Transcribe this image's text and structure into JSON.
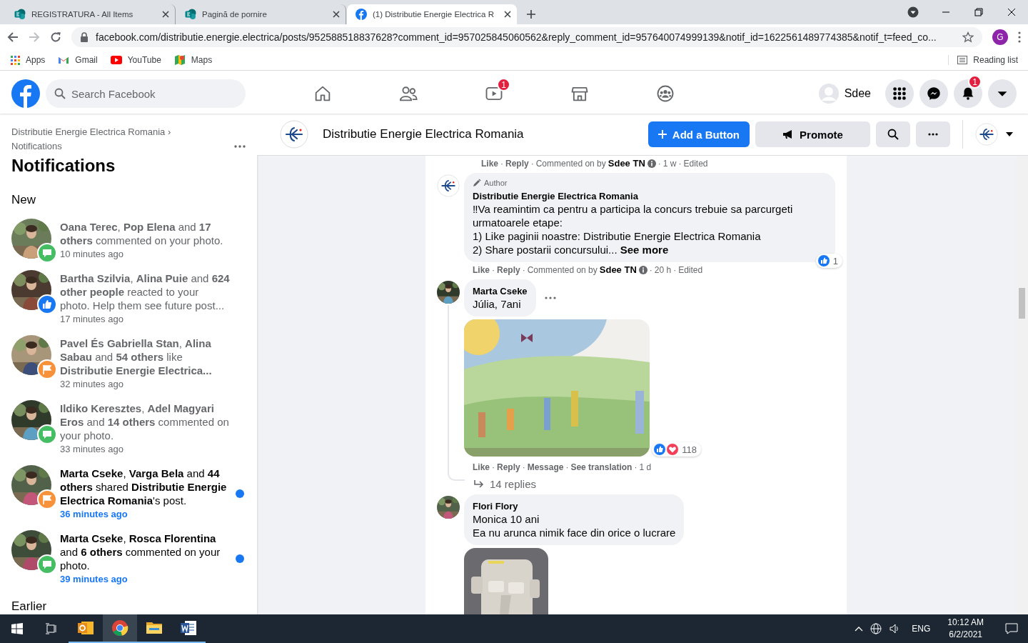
{
  "browser": {
    "tabs": [
      {
        "title": "REGISTRATURA - All Items",
        "kind": "sharepoint",
        "selected": false
      },
      {
        "title": "Pagină de pornire",
        "kind": "sharepoint",
        "selected": false
      },
      {
        "title": "(1) Distributie Energie Electrica R",
        "kind": "facebook",
        "selected": true
      }
    ],
    "address": "facebook.com/distributie.energie.electrica/posts/952588518837628?comment_id=957025845060562&reply_comment_id=957640074999139&notif_id=1622561489774385&notif_t=feed_co...",
    "profile_initial": "G",
    "bookmarks": [
      {
        "label": "Apps",
        "kind": "apps"
      },
      {
        "label": "Gmail",
        "kind": "gmail"
      },
      {
        "label": "YouTube",
        "kind": "youtube"
      },
      {
        "label": "Maps",
        "kind": "maps"
      }
    ],
    "reading_list": "Reading list"
  },
  "header": {
    "search_placeholder": "Search Facebook",
    "nav": [
      {
        "kind": "home"
      },
      {
        "kind": "friends"
      },
      {
        "kind": "watch",
        "badge": "1"
      },
      {
        "kind": "marketplace"
      },
      {
        "kind": "groups"
      }
    ],
    "profile_name": "Sdee",
    "actions": [
      {
        "kind": "menu"
      },
      {
        "kind": "messenger"
      },
      {
        "kind": "bell",
        "badge": "1"
      },
      {
        "kind": "caret"
      }
    ]
  },
  "sidebar": {
    "breadcrumb": "Distributie Energie Electrica Romania ›",
    "breadcrumb_current": "Notifications",
    "title": "Notifications",
    "sections": [
      {
        "heading": "New",
        "items": [
          {
            "text": "**Oana Terec**, **Pop Elena** and **17 others** commented on your photo.",
            "time": "10 minutes ago",
            "kind": "comment",
            "unread": false
          },
          {
            "text": "**Bartha Szilvia**, **Alina Puie** and **624 other people** reacted to your photo. Help them see future post...",
            "time": "17 minutes ago",
            "kind": "like",
            "unread": false
          },
          {
            "text": "**Pavel És Gabriella Stan**, **Alina Sabau** and **54 others** like **Distributie Energie Electrica...**",
            "time": "32 minutes ago",
            "kind": "page",
            "unread": false
          },
          {
            "text": "**Ildiko Keresztes**, **Adel Magyari Eros** and **14 others** commented on your photo.",
            "time": "33 minutes ago",
            "kind": "comment",
            "unread": false
          },
          {
            "text": "**Marta Cseke**, **Varga Bela** and **44 others** shared **Distributie Energie Electrica Romania**'s post.",
            "time": "36 minutes ago",
            "kind": "page",
            "unread": true
          },
          {
            "text": "**Marta Cseke**, **Rosca Florentina** and **6 others** commented on your photo.",
            "time": "39 minutes ago",
            "kind": "comment",
            "unread": true
          }
        ]
      },
      {
        "heading": "Earlier"
      }
    ]
  },
  "page_header": {
    "name": "Distributie Energie Electrica Romania",
    "buttons": [
      {
        "label": "Add a Button",
        "kind": "primary"
      },
      {
        "label": "Promote",
        "kind": "secondary"
      }
    ]
  },
  "comments": [
    {
      "kind": "meta_only",
      "meta": [
        {
          "kind": "action",
          "text": "Like"
        },
        {
          "kind": "sep",
          "text": "·"
        },
        {
          "kind": "action",
          "text": "Reply"
        },
        {
          "kind": "sep",
          "text": "·"
        },
        {
          "kind": "plain",
          "text": "Commented on by"
        },
        {
          "kind": "name",
          "text": "Sdee TN"
        },
        {
          "kind": "info"
        },
        {
          "kind": "sep",
          "text": "·"
        },
        {
          "kind": "plain",
          "text": "1 w"
        },
        {
          "kind": "sep",
          "text": "·"
        },
        {
          "kind": "plain",
          "text": "Edited"
        }
      ]
    },
    {
      "kind": "comment",
      "badge": "Author",
      "name": "Distributie Energie Electrica Romania",
      "lines": [
        "‼Va reamintim ca pentru a participa la concurs trebuie sa parcurgeti urmatoarele etape:",
        "1) Like paginii noastre: Distributie Energie Electrica Romania",
        "2) Share postarii concursului..."
      ],
      "see_more": "See more",
      "reactions": {
        "icons": [
          {
            "kind": "like"
          }
        ],
        "count": "1"
      },
      "meta": [
        {
          "kind": "action",
          "text": "Like"
        },
        {
          "kind": "sep",
          "text": "·"
        },
        {
          "kind": "action",
          "text": "Reply"
        },
        {
          "kind": "sep",
          "text": "·"
        },
        {
          "kind": "plain",
          "text": "Commented on by"
        },
        {
          "kind": "name",
          "text": "Sdee TN"
        },
        {
          "kind": "info"
        },
        {
          "kind": "sep",
          "text": "·"
        },
        {
          "kind": "plain",
          "text": "20 h"
        },
        {
          "kind": "sep",
          "text": "·"
        },
        {
          "kind": "plain",
          "text": "Edited"
        }
      ]
    },
    {
      "kind": "comment",
      "name": "Marta Cseke",
      "lines": [
        "Júlia, 7ani"
      ],
      "more_menu": true,
      "attachment": {
        "kind": "picture"
      },
      "reactions": {
        "icons": [
          {
            "kind": "like"
          },
          {
            "kind": "love"
          }
        ],
        "count": "118"
      },
      "meta": [
        {
          "kind": "action",
          "text": "Like"
        },
        {
          "kind": "sep",
          "text": "·"
        },
        {
          "kind": "action",
          "text": "Reply"
        },
        {
          "kind": "sep",
          "text": "·"
        },
        {
          "kind": "action",
          "text": "Message"
        },
        {
          "kind": "sep",
          "text": "·"
        },
        {
          "kind": "action",
          "text": "See translation"
        },
        {
          "kind": "sep",
          "text": "·"
        },
        {
          "kind": "plain",
          "text": "1 d"
        }
      ],
      "replies": "14 replies"
    },
    {
      "kind": "comment",
      "name": "Flori Flory",
      "lines": [
        "Monica 10 ani",
        "Ea nu arunca nimik face din orice o lucrare"
      ],
      "attachment": {
        "kind": "picture"
      }
    }
  ],
  "taskbar": {
    "apps": [
      {
        "kind": "start",
        "open": false
      },
      {
        "kind": "taskview",
        "open": false
      },
      {
        "kind": "outlook",
        "open": true
      },
      {
        "kind": "chrome",
        "open": true
      },
      {
        "kind": "explorer",
        "open": true
      },
      {
        "kind": "word",
        "open": true
      }
    ],
    "language": "ENG",
    "time": "10:12 AM",
    "date": "6/2/2021"
  }
}
